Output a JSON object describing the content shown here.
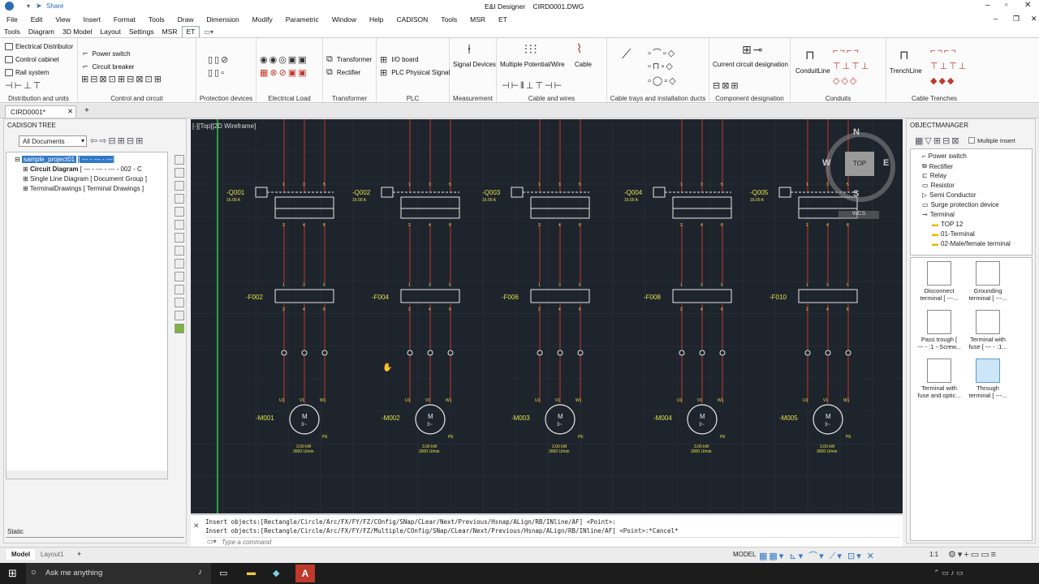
{
  "window": {
    "title": "E&I Designer    CIRD0001.DWG",
    "share": "Share"
  },
  "menu": [
    "File",
    "Edit",
    "View",
    "Insert",
    "Format",
    "Tools",
    "Draw",
    "Dimension",
    "Modify",
    "Parametric",
    "Window",
    "Help",
    "CADISON",
    "Tools",
    "MSR",
    "ET"
  ],
  "ribbon_tabs": [
    "Tools",
    "Diagram",
    "3D Model",
    "Layout",
    "Settings",
    "MSR",
    "ET"
  ],
  "ribbon": {
    "distribution": {
      "items": [
        "Electrical Distributor",
        "Control cabinet",
        "Rail system"
      ],
      "label": "Distribution and units"
    },
    "control": {
      "items": [
        "Power switch",
        "Circuit breaker"
      ],
      "label": "Control and circuit"
    },
    "protection": {
      "label": "Protection devices"
    },
    "load": {
      "label": "Electrical Load"
    },
    "transformer": {
      "items": [
        "Transformer",
        "Rectifier"
      ],
      "label": "Transformer"
    },
    "plc": {
      "items": [
        "I/O board",
        "PLC Physical Signal"
      ],
      "label": "PLC"
    },
    "measurement": {
      "item": "Signal Devices",
      "label": "Measurement"
    },
    "cable": {
      "items": [
        "Multiple Potential/Wire",
        "Cable"
      ],
      "label": "Cable and wires"
    },
    "trays": {
      "label": "Cable trays and installation ducts"
    },
    "designation": {
      "item": "Current circuit designation",
      "label": "Component designation"
    },
    "conduits": {
      "item": "ConduitLine",
      "label": "Conduits"
    },
    "trenches": {
      "item": "TrenchLine",
      "label": "Cable Trenches"
    }
  },
  "doc_tab": "CIRD0001*",
  "tree": {
    "title": "CADISON TREE",
    "dropdown": "All Documents",
    "rows": [
      {
        "label": "sample_project01",
        "extra": "[ --- - --- - ---]"
      },
      {
        "label": "Circuit Diagram",
        "extra": "[ --- - --- - --- - 002 - C"
      },
      {
        "label": "Single Line Diagram",
        "extra": "[ Document Group ]"
      },
      {
        "label": "TerminalDrawings",
        "extra": "[ Terminal Drawings ]"
      }
    ],
    "static": "Static"
  },
  "viewport": {
    "label": "[-][Top][2D Wireframe]",
    "compass": {
      "n": "N",
      "s": "S",
      "e": "E",
      "w": "W",
      "top": "TOP"
    },
    "wcs": "WCS"
  },
  "drawing": {
    "breakers": [
      "-Q001",
      "-Q002",
      "-Q003",
      "-Q004",
      "-Q005"
    ],
    "breaker_rating": "16.00 A",
    "fuses": [
      "-F002",
      "-F004",
      "-F006",
      "-F008",
      "-F010"
    ],
    "motors": [
      "-M001",
      "-M002",
      "-M003",
      "-M004",
      "-M005"
    ],
    "motor_power": "3.00 kW",
    "motor_speed": "3000 U/min",
    "terminals_top": [
      "1",
      "3",
      "5"
    ],
    "terminals_bottom": [
      "2",
      "4",
      "6"
    ],
    "phases": [
      "U1",
      "V1",
      "W1"
    ],
    "pe": "PE",
    "motor_symbol": "M",
    "motor_sub": "3~"
  },
  "object_manager": {
    "title": "OBJECTMANAGER",
    "multiple_insert": "Multiple Insert",
    "rows": [
      "Power switch",
      "Rectifier",
      "Relay",
      "Resistor",
      "Semi Conductor",
      "Surge protection device",
      "Terminal",
      "TOP 12",
      "01-Terminal",
      "02-Male/female terminal"
    ],
    "tiles": [
      {
        "line1": "Disconnect",
        "line2": "terminal    [ ---..."
      },
      {
        "line1": "Grounding",
        "line2": "terminal    [ ---..."
      },
      {
        "line1": "Pass trough  [",
        "line2": "--- - :1 - Screw..."
      },
      {
        "line1": "Terminal with",
        "line2": "fuse    [ --- - :1..."
      },
      {
        "line1": "Terminal with",
        "line2": "fuse and optic..."
      },
      {
        "line1": "Through",
        "line2": "terminal    [ ---..."
      }
    ]
  },
  "command": {
    "line1": "Insert objects:[Rectangle/Circle/Arc/FX/FY/FZ/COnfig/SNap/CLear/Next/Previous/Hsnap/ALign/RB/INline/AF] <Point>:",
    "line2": "Insert objects:[Rectangle/Circle/Arc/FX/FY/FZ/Multiple/COnfig/SNap/CLear/Next/Previous/Hsnap/ALign/RB/INline/AF] <Point>:*Cancel*",
    "placeholder": "Type a command"
  },
  "status": {
    "model_tab": "Model",
    "layout_tab": "Layout1",
    "model": "MODEL",
    "scale": "1:1"
  },
  "taskbar": {
    "search": "Ask me anything"
  },
  "colors": {
    "canvas": "#1e242c",
    "wire": "#c0392b",
    "symbol": "#e8e8e8",
    "label": "#e8e04a",
    "green": "#2ecc40"
  }
}
